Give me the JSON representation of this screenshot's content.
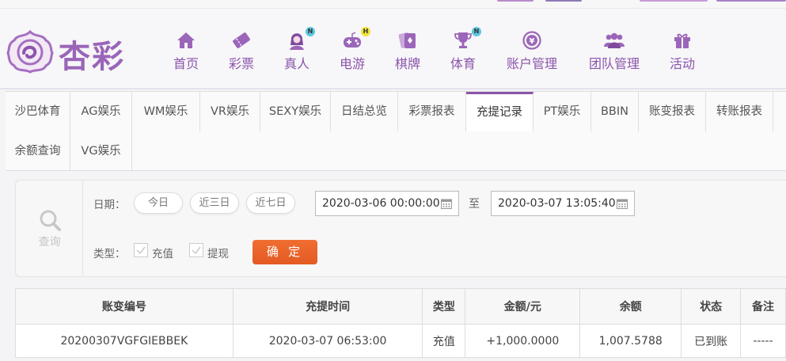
{
  "colors": {
    "brand": "#8a55aa",
    "confirm": "#e8622b",
    "amount": "#c0141b",
    "status_ok": "#1f9e22"
  },
  "logo": {
    "text": "杏彩"
  },
  "nav": [
    {
      "label": "首页",
      "icon": "home-icon"
    },
    {
      "label": "彩票",
      "icon": "ticket-icon"
    },
    {
      "label": "真人",
      "icon": "live-dealer-icon",
      "badge": "N"
    },
    {
      "label": "电游",
      "icon": "gamepad-icon",
      "badge": "H"
    },
    {
      "label": "棋牌",
      "icon": "cards-icon"
    },
    {
      "label": "体育",
      "icon": "trophy-icon",
      "badge": "N"
    },
    {
      "label": "账户管理",
      "icon": "yen-coin-icon"
    },
    {
      "label": "团队管理",
      "icon": "team-icon"
    },
    {
      "label": "活动",
      "icon": "gift-icon"
    }
  ],
  "tabs": [
    {
      "label": "沙巴体育"
    },
    {
      "label": "AG娱乐"
    },
    {
      "label": "WM娱乐"
    },
    {
      "label": "VR娱乐"
    },
    {
      "label": "SEXY娱乐"
    },
    {
      "label": "日结总览"
    },
    {
      "label": "彩票报表"
    },
    {
      "label": "充提记录",
      "active": true
    },
    {
      "label": "PT娱乐"
    },
    {
      "label": "BBIN"
    },
    {
      "label": "账变报表"
    },
    {
      "label": "转账报表"
    },
    {
      "label": "余额查询"
    },
    {
      "label": "VG娱乐"
    }
  ],
  "query": {
    "title": "查询",
    "date_label": "日期：",
    "quick_ranges": [
      "今日",
      "近三日",
      "近七日"
    ],
    "start": "2020-03-06 00:00:00",
    "separator": "至",
    "end": "2020-03-07 13:05:40",
    "type_label": "类型：",
    "types": [
      {
        "label": "充值",
        "checked": true
      },
      {
        "label": "提现",
        "checked": true
      }
    ],
    "confirm": "确 定"
  },
  "table": {
    "headers": [
      "账变编号",
      "充提时间",
      "类型",
      "金额/元",
      "余额",
      "状态",
      "备注"
    ],
    "rows": [
      [
        "20200307VGFGIEBBEK",
        "2020-03-07 06:53:00",
        "充值",
        "+1,000.0000",
        "1,007.5788",
        "已到账",
        "-----"
      ]
    ]
  }
}
